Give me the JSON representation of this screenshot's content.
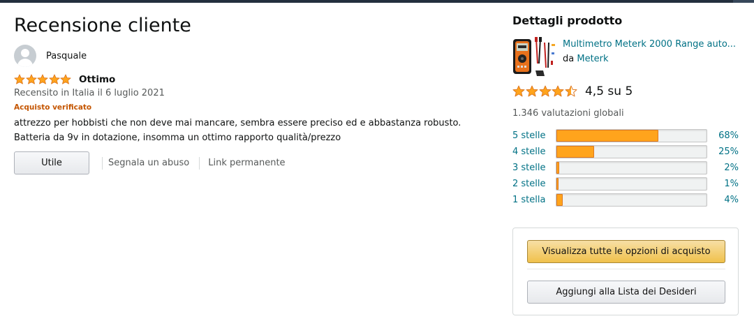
{
  "colors": {
    "star": "#ffa41c",
    "star_stroke": "#de7921",
    "link": "#007185",
    "verified": "#c45500",
    "primary_button": "#f0c14b"
  },
  "review": {
    "page_title": "Recensione cliente",
    "author": "Pasquale",
    "avatar_icon": "user-avatar-icon",
    "rating": 5,
    "title": "Ottimo",
    "date": "Recensito in Italia il 6 luglio 2021",
    "verified": "Acquisto verificato",
    "body_line1": "attrezzo per hobbisti che non deve mai mancare, sembra essere preciso ed e abbastanza robusto.",
    "body_line2": "Batteria da 9v in dotazione, insomma un ottimo rapporto qualità/prezzo",
    "helpful_label": "Utile",
    "report_label": "Segnala un abuso",
    "permalink_label": "Link permanente"
  },
  "product": {
    "section_title": "Dettagli prodotto",
    "name": "Multimetro Meterk 2000 Range auto...",
    "by": "da",
    "brand": "Meterk",
    "thumbnail_icon": "multimeter-product-image",
    "average_rating": 4.5,
    "rating_text": "4,5 su 5",
    "total_ratings": "1.346 valutazioni globali"
  },
  "histogram": [
    {
      "label": "5 stelle",
      "percent": 68,
      "percent_label": "68%"
    },
    {
      "label": "4 stelle",
      "percent": 25,
      "percent_label": "25%"
    },
    {
      "label": "3 stelle",
      "percent": 2,
      "percent_label": "2%"
    },
    {
      "label": "2 stelle",
      "percent": 1,
      "percent_label": "1%"
    },
    {
      "label": "1 stella",
      "percent": 4,
      "percent_label": "4%"
    }
  ],
  "buy_box": {
    "see_options_label": "Visualizza tutte le opzioni di acquisto",
    "wishlist_label": "Aggiungi alla Lista dei Desideri"
  }
}
